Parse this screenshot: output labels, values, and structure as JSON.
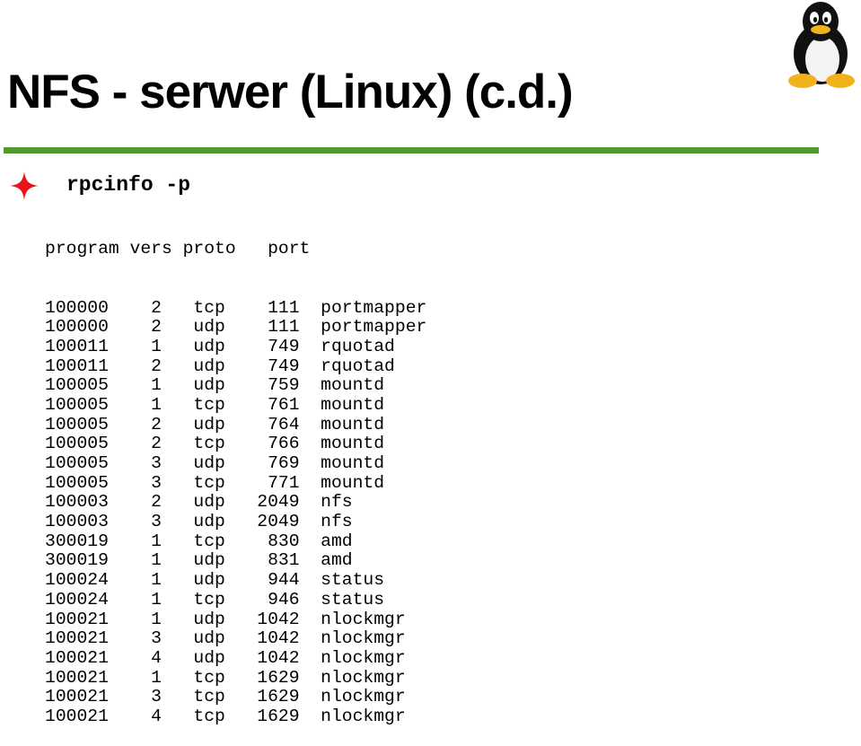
{
  "slide": {
    "title": "NFS - serwer (Linux) (c.d.)",
    "command": "rpcinfo -p",
    "header": "program vers proto   port",
    "rows": [
      "100000    2   tcp    111  portmapper",
      "100000    2   udp    111  portmapper",
      "100011    1   udp    749  rquotad",
      "100011    2   udp    749  rquotad",
      "100005    1   udp    759  mountd",
      "100005    1   tcp    761  mountd",
      "100005    2   udp    764  mountd",
      "100005    2   tcp    766  mountd",
      "100005    3   udp    769  mountd",
      "100005    3   tcp    771  mountd",
      "100003    2   udp   2049  nfs",
      "100003    3   udp   2049  nfs",
      "300019    1   tcp    830  amd",
      "300019    1   udp    831  amd",
      "100024    1   udp    944  status",
      "100024    1   tcp    946  status",
      "100021    1   udp   1042  nlockmgr",
      "100021    3   udp   1042  nlockmgr",
      "100021    4   udp   1042  nlockmgr",
      "100021    1   tcp   1629  nlockmgr",
      "100021    3   tcp   1629  nlockmgr",
      "100021    4   tcp   1629  nlockmgr"
    ]
  },
  "colors": {
    "rule": "#4f9a2c",
    "bullet": "#e8141c"
  },
  "icons": {
    "logo": "tux-penguin-icon",
    "bullet": "four-point-star-icon"
  }
}
